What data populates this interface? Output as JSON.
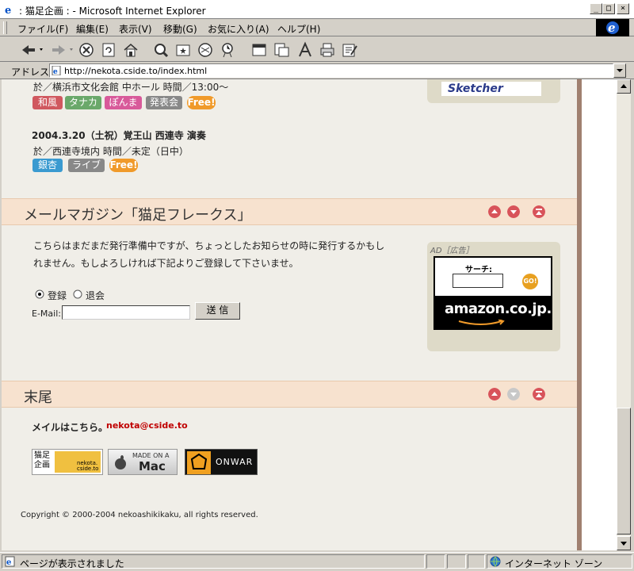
{
  "window": {
    "title": ": 猫足企画 : - Microsoft Internet Explorer"
  },
  "menu": [
    "ファイル(F)",
    "編集(E)",
    "表示(V)",
    "移動(G)",
    "お気に入り(A)",
    "ヘルプ(H)"
  ],
  "address": {
    "label": "アドレス",
    "url": "http://nekota.cside.to/index.html"
  },
  "content": {
    "event1": {
      "partial": "於／横浜市文化会館 中ホール 時間／13:00～",
      "tags": [
        "和風",
        "タナカ",
        "ぽんま",
        "発表会",
        "Free!"
      ]
    },
    "event2": {
      "date": "2004.3.20（土祝）覚王山 西連寺 演奏",
      "detail": "於／西連寺境内 時間／未定（日中）",
      "tags": [
        "銀杏",
        "ライブ",
        "Free!"
      ]
    },
    "sketcher": "Sketcher",
    "mail_section": {
      "title": "メールマガジン「猫足フレークス」",
      "body1": "こちらはまだまだ発行準備中ですが、ちょっとしたお知らせの時に発行するかもし",
      "body2": "れません。もしよろしければ下記よりご登録して下さいませ。",
      "radio_subscribe": "登録",
      "radio_unsubscribe": "退会",
      "email_label": "E-Mail:",
      "email_value": "",
      "submit": "送 信"
    },
    "ad": {
      "label": "AD［広告］",
      "search_label": "サーチ:",
      "go": "GO!",
      "brand": "amazon.co.jp."
    },
    "end_section": {
      "title": "末尾",
      "mail_text": "メイルはこちら。",
      "mail_addr": "nekota@cside.to",
      "badges": {
        "nekota_l1": "猫足",
        "nekota_l2": "企画",
        "nekota_url1": "nekota.",
        "nekota_url2": "cside.to",
        "mac_top": "MADE ON A",
        "mac_bottom": "Mac",
        "onwar": "ONWAR"
      },
      "copyright": "Copyright © 2000-2004 nekoashikikaku, all rights reserved."
    }
  },
  "status": {
    "text": "ページが表示されました",
    "zone": "インターネット ゾーン"
  },
  "colors": {
    "accent": "#c00000",
    "section_bg": "#f7e2cf",
    "page_bg": "#f0eee8"
  }
}
